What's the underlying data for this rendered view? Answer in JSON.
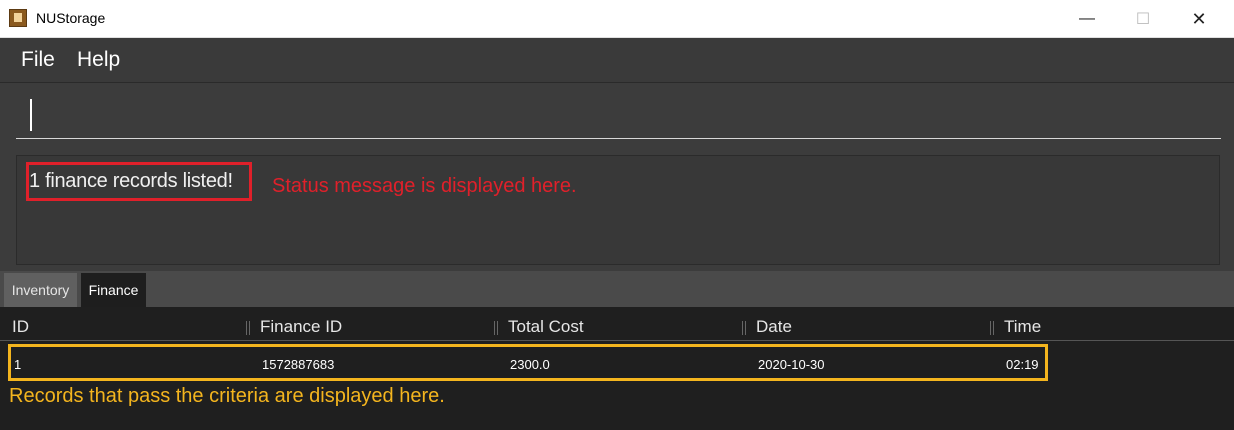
{
  "window": {
    "title": "NUStorage",
    "minimize_symbol": "—",
    "maximize_symbol": "☐",
    "close_symbol": "✕"
  },
  "menu": {
    "items": [
      {
        "label": "File"
      },
      {
        "label": "Help"
      }
    ]
  },
  "command_box": {
    "value": ""
  },
  "result_display": {
    "status": "1 finance records listed!",
    "annotation": "Status message is displayed here."
  },
  "tabs": [
    {
      "label": "Inventory",
      "selected": false
    },
    {
      "label": "Finance",
      "selected": true
    }
  ],
  "table": {
    "columns": [
      "ID",
      "Finance ID",
      "Total Cost",
      "Date",
      "Time"
    ],
    "rows": [
      [
        "1",
        "1572887683",
        "2300.0",
        "2020-10-30",
        "02:19"
      ]
    ],
    "annotation": "Records that pass the criteria are displayed here."
  },
  "colors": {
    "status_highlight": "#e0202a",
    "records_highlight": "#f4b51e",
    "background": "#3c3c3c"
  },
  "icons": {
    "app": "storage-app-icon"
  }
}
